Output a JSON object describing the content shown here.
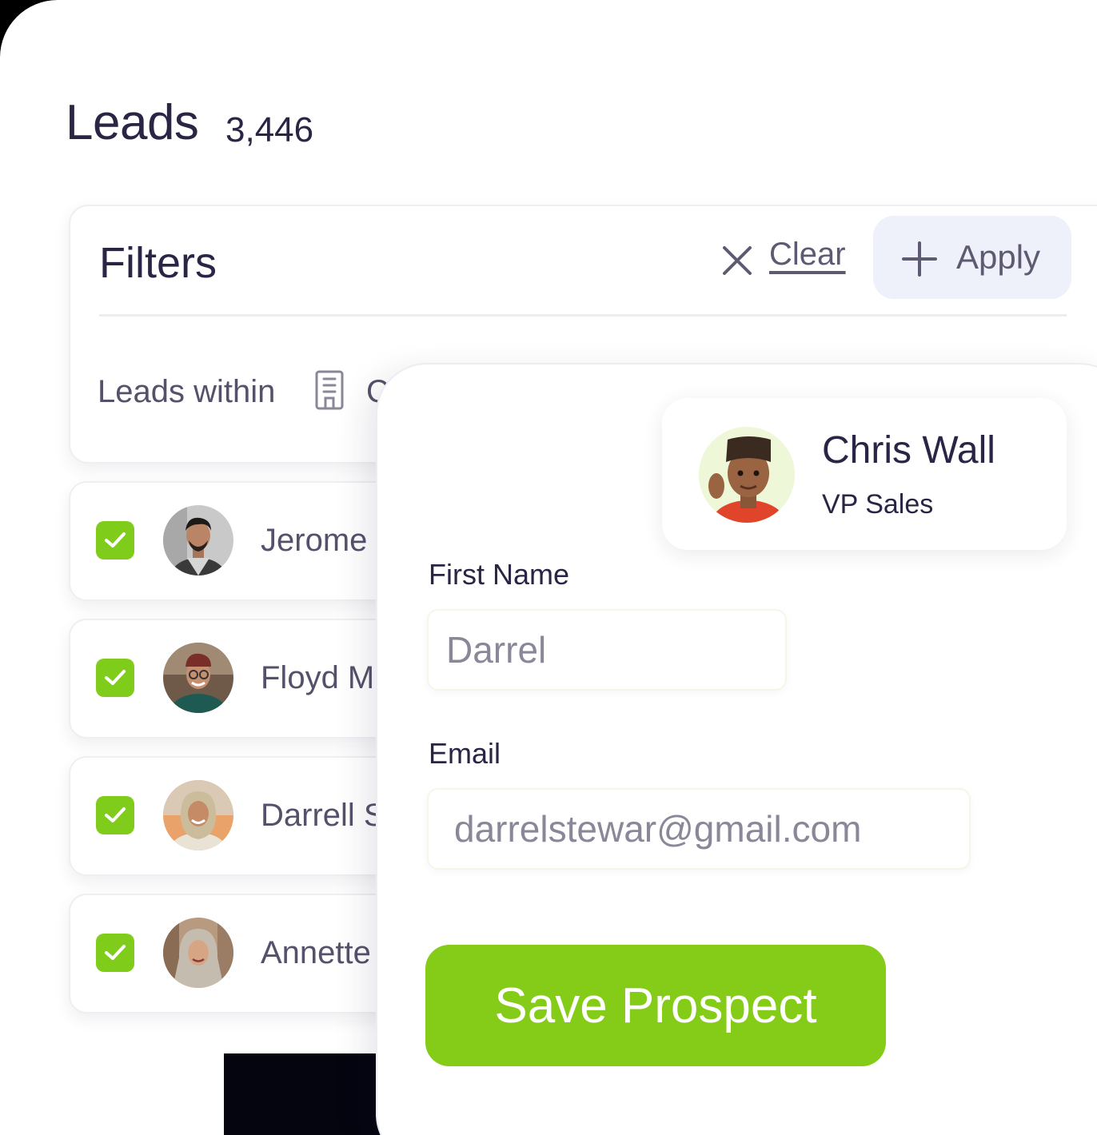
{
  "header": {
    "title": "Leads",
    "count": "3,446"
  },
  "filters": {
    "title": "Filters",
    "clear_label": "Clear",
    "apply_label": "Apply",
    "leads_within_label": "Leads within",
    "within_value_visible": "C"
  },
  "leads": [
    {
      "name": "Jerome",
      "checked": true
    },
    {
      "name": "Floyd M",
      "checked": true
    },
    {
      "name": "Darrell S",
      "checked": true
    },
    {
      "name": "Annette",
      "checked": true
    }
  ],
  "prospect_form": {
    "owner": {
      "name": "Chris Wall",
      "role": "VP Sales"
    },
    "first_name_label": "First Name",
    "first_name_value": "Darrel",
    "email_label": "Email",
    "email_value": "darrelstewar@gmail.com",
    "save_label": "Save Prospect"
  },
  "colors": {
    "accent_green": "#84cc17",
    "text_dark": "#2b2545",
    "apply_bg": "#eef0fa"
  }
}
